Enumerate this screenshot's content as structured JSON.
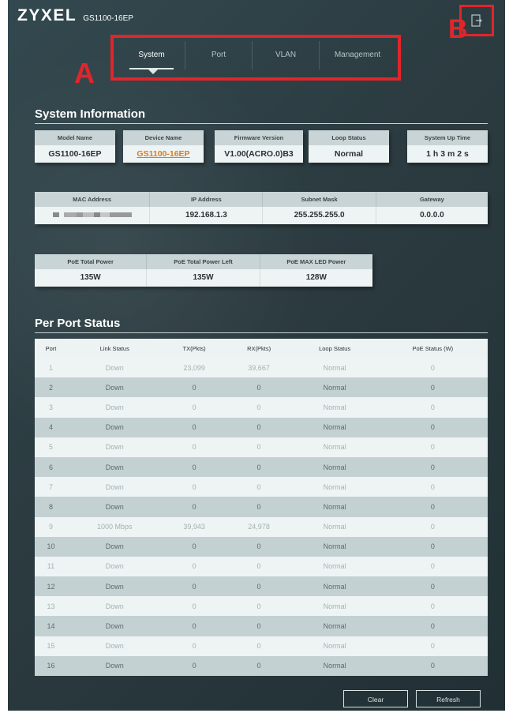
{
  "header": {
    "logo": "ZYXEL",
    "model": "GS1100-16EP",
    "marker_a": "A",
    "marker_b": "B",
    "logout_icon": "logout-icon"
  },
  "tabs": [
    {
      "label": "System",
      "active": true
    },
    {
      "label": "Port",
      "active": false
    },
    {
      "label": "VLAN",
      "active": false
    },
    {
      "label": "Management",
      "active": false
    }
  ],
  "system_info": {
    "title": "System Information",
    "cards": [
      {
        "label": "Model Name",
        "value": "GS1100-16EP"
      },
      {
        "label": "Device Name",
        "value": "GS1100-16EP"
      },
      {
        "label": "Firmware Version",
        "value": "V1.00(ACRO.0)B3"
      },
      {
        "label": "Loop Status",
        "value": "Normal"
      },
      {
        "label": "System Up Time",
        "value": "1 h 3 m 2 s"
      }
    ],
    "network": {
      "headers": [
        "MAC Address",
        "IP Address",
        "Subnet Mask",
        "Gateway"
      ],
      "values": [
        "",
        "192.168.1.3",
        "255.255.255.0",
        "0.0.0.0"
      ]
    },
    "poe": {
      "headers": [
        "PoE Total Power",
        "PoE Total Power Left",
        "PoE MAX LED Power"
      ],
      "values": [
        "135W",
        "135W",
        "128W"
      ]
    }
  },
  "port_status": {
    "title": "Per Port Status",
    "columns": [
      "Port",
      "Link Status",
      "TX(Pkts)",
      "RX(Pkts)",
      "Loop Status",
      "PoE Status (W)"
    ],
    "rows": [
      [
        "1",
        "Down",
        "23,099",
        "39,667",
        "Normal",
        "0"
      ],
      [
        "2",
        "Down",
        "0",
        "0",
        "Normal",
        "0"
      ],
      [
        "3",
        "Down",
        "0",
        "0",
        "Normal",
        "0"
      ],
      [
        "4",
        "Down",
        "0",
        "0",
        "Normal",
        "0"
      ],
      [
        "5",
        "Down",
        "0",
        "0",
        "Normal",
        "0"
      ],
      [
        "6",
        "Down",
        "0",
        "0",
        "Normal",
        "0"
      ],
      [
        "7",
        "Down",
        "0",
        "0",
        "Normal",
        "0"
      ],
      [
        "8",
        "Down",
        "0",
        "0",
        "Normal",
        "0"
      ],
      [
        "9",
        "1000 Mbps",
        "39,943",
        "24,978",
        "Normal",
        "0"
      ],
      [
        "10",
        "Down",
        "0",
        "0",
        "Normal",
        "0"
      ],
      [
        "11",
        "Down",
        "0",
        "0",
        "Normal",
        "0"
      ],
      [
        "12",
        "Down",
        "0",
        "0",
        "Normal",
        "0"
      ],
      [
        "13",
        "Down",
        "0",
        "0",
        "Normal",
        "0"
      ],
      [
        "14",
        "Down",
        "0",
        "0",
        "Normal",
        "0"
      ],
      [
        "15",
        "Down",
        "0",
        "0",
        "Normal",
        "0"
      ],
      [
        "16",
        "Down",
        "0",
        "0",
        "Normal",
        "0"
      ]
    ]
  },
  "buttons": {
    "clear": "Clear",
    "refresh": "Refresh"
  },
  "colors": {
    "annotation_red": "#e2252b",
    "link_orange": "#e07b18"
  }
}
